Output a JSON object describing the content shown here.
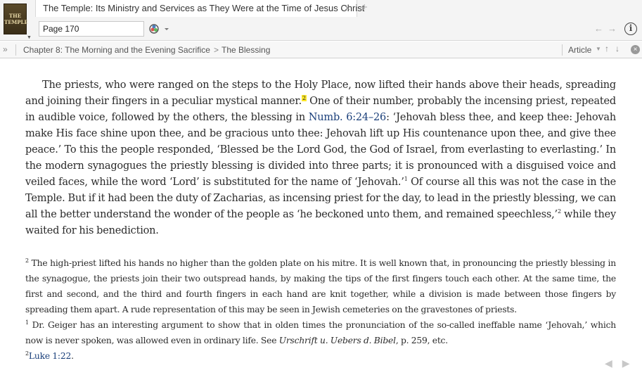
{
  "tab": {
    "cover_text": "THE TEMPLE",
    "title": "The Temple: Its Ministry and Services as They Were at the Time of Jesus Christ",
    "close_symbol": "×",
    "new_tab_symbol": "+"
  },
  "toolbar": {
    "page_value": "Page 170",
    "back_symbol": "←",
    "forward_symbol": "→",
    "info_symbol": "i"
  },
  "breadcrumb": {
    "expand_symbol": "»",
    "chapter": "Chapter 8: The Morning and the Evening Sacrifice",
    "separator": ">",
    "section": "The Blessing",
    "article_label": "Article",
    "up_symbol": "↑",
    "down_symbol": "↓",
    "close_symbol": "×"
  },
  "body": {
    "p1": "The priests, who were ranged on the steps to the Holy Place, now lifted their hands above their heads, spreading and joining their fingers in a peculiar mystical manner.",
    "p1_marker": "2",
    "p2": " One of their number, probably the incensing priest, repeated in audible voice, followed by the others, the blessing in ",
    "ref_numb": "Numb. 6:24–26",
    "p3": ": ‘Jehovah bless thee, and keep thee: Jehovah make His face shine upon thee, and be gracious unto thee: Jehovah lift up His countenance upon thee, and give thee peace.’ To this the people responded, ‘Blessed be the Lord God, the God of Israel, from everlasting to everlasting.’ In the modern synagogues the priestly blessing is divided into three parts; it is pronounced with a disguised voice and veiled faces, while the word ‘Lord’ is substituted for the name of ‘Jehovah.’",
    "p3_marker": "1",
    "p4": " Of course all this was not the case in the Temple. But if it had been the duty of Zacharias, as incensing priest for the day, to lead in the priestly blessing, we can all the better understand the wonder of the people as ‘he beckoned unto them, and remained speechless,’",
    "p4_marker": "2",
    "p5": " while they waited for his benediction."
  },
  "footnotes": {
    "n1_marker": "2",
    "n1_text": " The high-priest lifted his hands no higher than the golden plate on his mitre. It is well known that, in pronouncing the priestly blessing in the synagogue, the priests join their two outspread hands, by making the tips of the first fingers touch each other. At the same time, the first and second, and the third and fourth fingers in each hand are knit together, while a division is made between those fingers by spreading them apart. A rude representation of this may be seen in Jewish cemeteries on the gravestones of priests.",
    "n2_marker": "1",
    "n2_text_a": " Dr. Geiger has an interesting argument to show that in olden times the pronunciation of the so-called ineffable name ‘Jehovah,’ which now is never spoken, was allowed even in ordinary life. See ",
    "n2_italic": "Urschrift u. Uebers d. Bibel",
    "n2_text_b": ", p. 259, etc.",
    "n3_marker": "2",
    "n3_ref": "Luke 1:22",
    "n3_end": "."
  },
  "bottom_nav": {
    "prev_symbol": "◀",
    "next_symbol": "▶"
  },
  "colors": {
    "link": "#1a3f7a",
    "highlight": "#ffe92b"
  }
}
